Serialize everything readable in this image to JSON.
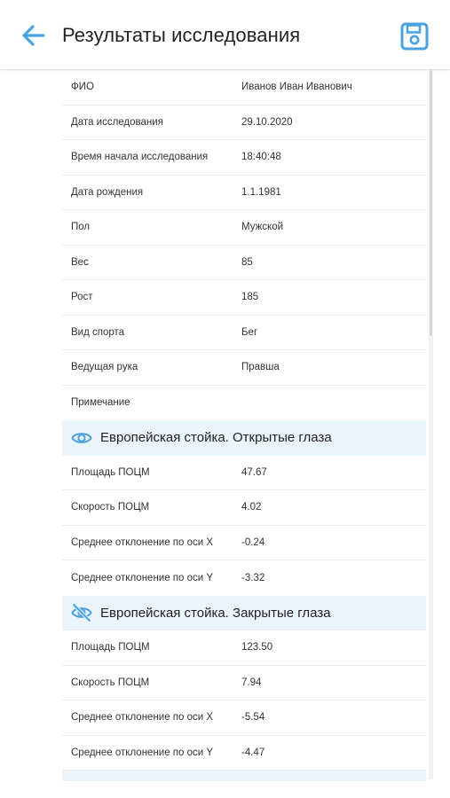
{
  "header": {
    "title": "Результаты исследования"
  },
  "info": [
    {
      "label": "ФИО",
      "value": "Иванов Иван Иванович"
    },
    {
      "label": "Дата исследования",
      "value": "29.10.2020"
    },
    {
      "label": "Время начала исследования",
      "value": "18:40:48"
    },
    {
      "label": "Дата рождения",
      "value": "1.1.1981"
    },
    {
      "label": "Пол",
      "value": "Мужской"
    },
    {
      "label": "Вес",
      "value": "85"
    },
    {
      "label": "Рост",
      "value": "185"
    },
    {
      "label": "Вид спорта",
      "value": "Бег"
    },
    {
      "label": "Ведущая рука",
      "value": "Правша"
    },
    {
      "label": "Примечание",
      "value": ""
    }
  ],
  "sections": [
    {
      "title": "Европейская стойка. Открытые глаза",
      "icon": "eye-open-icon",
      "rows": [
        {
          "label": "Площадь ПОЦМ",
          "value": "47.67"
        },
        {
          "label": "Скорость ПОЦМ",
          "value": "4.02"
        },
        {
          "label": "Среднее отклонение по оси X",
          "value": "-0.24"
        },
        {
          "label": "Среднее отклонение по оси Y",
          "value": "-3.32"
        }
      ]
    },
    {
      "title": "Европейская стойка. Закрытые глаза",
      "icon": "eye-closed-icon",
      "rows": [
        {
          "label": "Площадь ПОЦМ",
          "value": "123.50"
        },
        {
          "label": "Скорость ПОЦМ",
          "value": "7.94"
        },
        {
          "label": "Среднее отклонение по оси X",
          "value": "-5.54"
        },
        {
          "label": "Среднее отклонение по оси Y",
          "value": "-4.47"
        }
      ]
    }
  ],
  "colors": {
    "accent": "#4aa3df",
    "section_bg": "#eaf4fb",
    "divider": "#ececec"
  }
}
